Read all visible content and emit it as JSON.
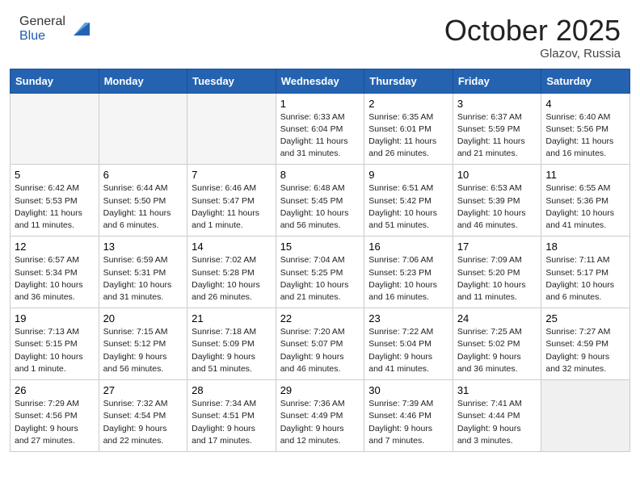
{
  "header": {
    "logo_general": "General",
    "logo_blue": "Blue",
    "month_title": "October 2025",
    "location": "Glazov, Russia"
  },
  "days_of_week": [
    "Sunday",
    "Monday",
    "Tuesday",
    "Wednesday",
    "Thursday",
    "Friday",
    "Saturday"
  ],
  "weeks": [
    [
      {
        "day": "",
        "info": ""
      },
      {
        "day": "",
        "info": ""
      },
      {
        "day": "",
        "info": ""
      },
      {
        "day": "1",
        "info": "Sunrise: 6:33 AM\nSunset: 6:04 PM\nDaylight: 11 hours\nand 31 minutes."
      },
      {
        "day": "2",
        "info": "Sunrise: 6:35 AM\nSunset: 6:01 PM\nDaylight: 11 hours\nand 26 minutes."
      },
      {
        "day": "3",
        "info": "Sunrise: 6:37 AM\nSunset: 5:59 PM\nDaylight: 11 hours\nand 21 minutes."
      },
      {
        "day": "4",
        "info": "Sunrise: 6:40 AM\nSunset: 5:56 PM\nDaylight: 11 hours\nand 16 minutes."
      }
    ],
    [
      {
        "day": "5",
        "info": "Sunrise: 6:42 AM\nSunset: 5:53 PM\nDaylight: 11 hours\nand 11 minutes."
      },
      {
        "day": "6",
        "info": "Sunrise: 6:44 AM\nSunset: 5:50 PM\nDaylight: 11 hours\nand 6 minutes."
      },
      {
        "day": "7",
        "info": "Sunrise: 6:46 AM\nSunset: 5:47 PM\nDaylight: 11 hours\nand 1 minute."
      },
      {
        "day": "8",
        "info": "Sunrise: 6:48 AM\nSunset: 5:45 PM\nDaylight: 10 hours\nand 56 minutes."
      },
      {
        "day": "9",
        "info": "Sunrise: 6:51 AM\nSunset: 5:42 PM\nDaylight: 10 hours\nand 51 minutes."
      },
      {
        "day": "10",
        "info": "Sunrise: 6:53 AM\nSunset: 5:39 PM\nDaylight: 10 hours\nand 46 minutes."
      },
      {
        "day": "11",
        "info": "Sunrise: 6:55 AM\nSunset: 5:36 PM\nDaylight: 10 hours\nand 41 minutes."
      }
    ],
    [
      {
        "day": "12",
        "info": "Sunrise: 6:57 AM\nSunset: 5:34 PM\nDaylight: 10 hours\nand 36 minutes."
      },
      {
        "day": "13",
        "info": "Sunrise: 6:59 AM\nSunset: 5:31 PM\nDaylight: 10 hours\nand 31 minutes."
      },
      {
        "day": "14",
        "info": "Sunrise: 7:02 AM\nSunset: 5:28 PM\nDaylight: 10 hours\nand 26 minutes."
      },
      {
        "day": "15",
        "info": "Sunrise: 7:04 AM\nSunset: 5:25 PM\nDaylight: 10 hours\nand 21 minutes."
      },
      {
        "day": "16",
        "info": "Sunrise: 7:06 AM\nSunset: 5:23 PM\nDaylight: 10 hours\nand 16 minutes."
      },
      {
        "day": "17",
        "info": "Sunrise: 7:09 AM\nSunset: 5:20 PM\nDaylight: 10 hours\nand 11 minutes."
      },
      {
        "day": "18",
        "info": "Sunrise: 7:11 AM\nSunset: 5:17 PM\nDaylight: 10 hours\nand 6 minutes."
      }
    ],
    [
      {
        "day": "19",
        "info": "Sunrise: 7:13 AM\nSunset: 5:15 PM\nDaylight: 10 hours\nand 1 minute."
      },
      {
        "day": "20",
        "info": "Sunrise: 7:15 AM\nSunset: 5:12 PM\nDaylight: 9 hours\nand 56 minutes."
      },
      {
        "day": "21",
        "info": "Sunrise: 7:18 AM\nSunset: 5:09 PM\nDaylight: 9 hours\nand 51 minutes."
      },
      {
        "day": "22",
        "info": "Sunrise: 7:20 AM\nSunset: 5:07 PM\nDaylight: 9 hours\nand 46 minutes."
      },
      {
        "day": "23",
        "info": "Sunrise: 7:22 AM\nSunset: 5:04 PM\nDaylight: 9 hours\nand 41 minutes."
      },
      {
        "day": "24",
        "info": "Sunrise: 7:25 AM\nSunset: 5:02 PM\nDaylight: 9 hours\nand 36 minutes."
      },
      {
        "day": "25",
        "info": "Sunrise: 7:27 AM\nSunset: 4:59 PM\nDaylight: 9 hours\nand 32 minutes."
      }
    ],
    [
      {
        "day": "26",
        "info": "Sunrise: 7:29 AM\nSunset: 4:56 PM\nDaylight: 9 hours\nand 27 minutes."
      },
      {
        "day": "27",
        "info": "Sunrise: 7:32 AM\nSunset: 4:54 PM\nDaylight: 9 hours\nand 22 minutes."
      },
      {
        "day": "28",
        "info": "Sunrise: 7:34 AM\nSunset: 4:51 PM\nDaylight: 9 hours\nand 17 minutes."
      },
      {
        "day": "29",
        "info": "Sunrise: 7:36 AM\nSunset: 4:49 PM\nDaylight: 9 hours\nand 12 minutes."
      },
      {
        "day": "30",
        "info": "Sunrise: 7:39 AM\nSunset: 4:46 PM\nDaylight: 9 hours\nand 7 minutes."
      },
      {
        "day": "31",
        "info": "Sunrise: 7:41 AM\nSunset: 4:44 PM\nDaylight: 9 hours\nand 3 minutes."
      },
      {
        "day": "",
        "info": ""
      }
    ]
  ]
}
